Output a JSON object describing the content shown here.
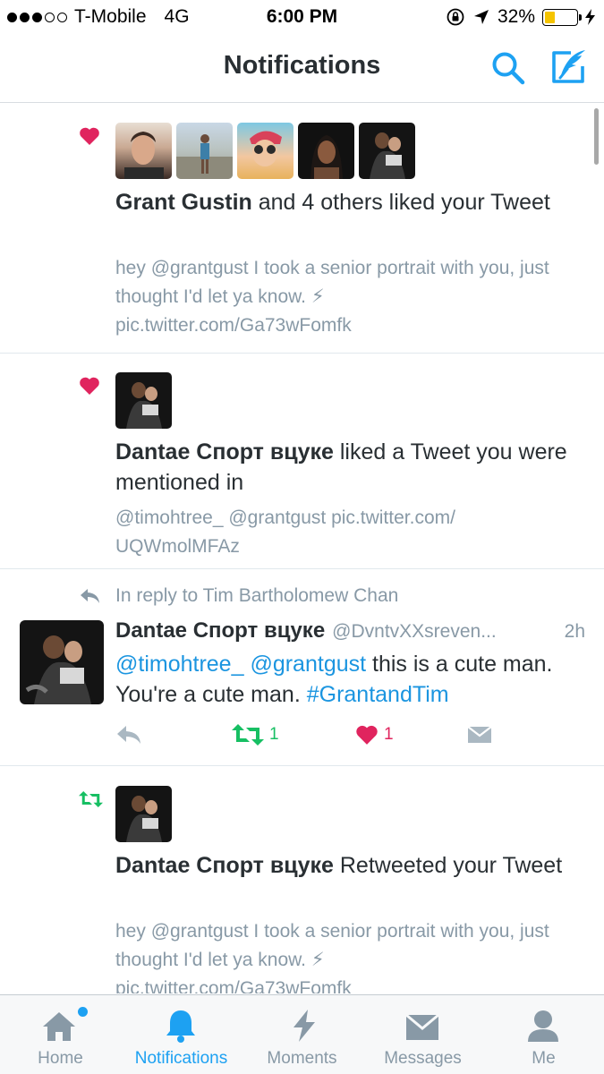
{
  "status_bar": {
    "carrier": "T-Mobile",
    "network": "4G",
    "time": "6:00 PM",
    "battery_percent": "32%",
    "battery_level": 0.32,
    "signal_bars_filled": 3,
    "signal_bars_total": 5
  },
  "header": {
    "title": "Notifications",
    "search_icon": "search-icon",
    "compose_icon": "compose-tweet-icon"
  },
  "notifications": [
    {
      "type": "like",
      "icon": "heart-icon",
      "avatar_count": 5,
      "name": "Grant Gustin",
      "text": " and 4 others liked your Tweet",
      "snippet": "hey @grantgust I took a senior portrait with you, just thought I'd let ya know. ⚡ pic.twitter.com/Ga73wFomfk"
    },
    {
      "type": "like",
      "icon": "heart-icon",
      "name": "Dantae Спорт вцуке",
      "text": " liked a Tweet you were mentioned in",
      "snippet": "@timohtree_ @grantgust pic.twitter.com/ UQWmolMFAz"
    },
    {
      "type": "reply",
      "context_icon": "reply-arrow-icon",
      "context": "In reply to Tim Bartholomew Chan",
      "name": "Dantae Спорт вцуке",
      "handle": "@DvntvXXsreven...",
      "time": "2h",
      "mention1": "@timohtree_",
      "mention2": "@grantgust",
      "text_part": " this is a cute man. You're a cute man. ",
      "hashtag": "#GrantandTim",
      "retweet_count": "1",
      "like_count": "1"
    },
    {
      "type": "retweet",
      "icon": "retweet-icon",
      "name": "Dantae Спорт вцуке",
      "text": " Retweeted your Tweet",
      "snippet": "hey @grantgust I took a senior portrait with you, just thought I'd let ya know. ⚡ pic.twitter.com/Ga73wFomfk"
    }
  ],
  "tabs": [
    {
      "label": "Home",
      "icon": "home-icon",
      "active": false,
      "has_dot": true
    },
    {
      "label": "Notifications",
      "icon": "bell-icon",
      "active": true
    },
    {
      "label": "Moments",
      "icon": "lightning-icon",
      "active": false
    },
    {
      "label": "Messages",
      "icon": "envelope-icon",
      "active": false
    },
    {
      "label": "Me",
      "icon": "person-icon",
      "active": false
    }
  ],
  "colors": {
    "accent": "#1da1f2",
    "like": "#e0245e",
    "retweet": "#17bf63",
    "muted": "#8899a6",
    "text": "#292f33"
  }
}
